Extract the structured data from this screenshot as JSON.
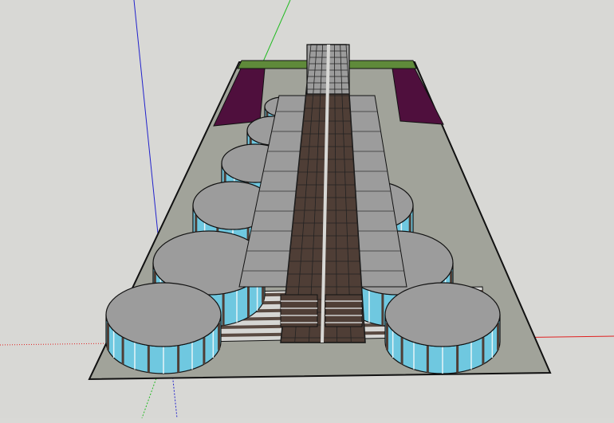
{
  "app": {
    "title": ""
  },
  "viewport": {
    "background_color": "#d8d8d5",
    "axes": [
      {
        "name": "red-axis",
        "color": "#e02020"
      },
      {
        "name": "green-axis",
        "color": "#22bb22"
      },
      {
        "name": "blue-axis",
        "color": "#2222cc"
      }
    ]
  },
  "model": {
    "description_icon": "building-model-icon",
    "colors": {
      "ground_plate": "#a1a39a",
      "green_strip": "#5f8a3a",
      "purple_patch": "#4f0f3d",
      "roof": "#9c9c9c",
      "wall_light": "#d6d6d4",
      "window_brown": "#4f3e36",
      "glass_cyan": "#6fc8e0",
      "glass_light": "#cfecf2",
      "edge": "#111111"
    }
  }
}
